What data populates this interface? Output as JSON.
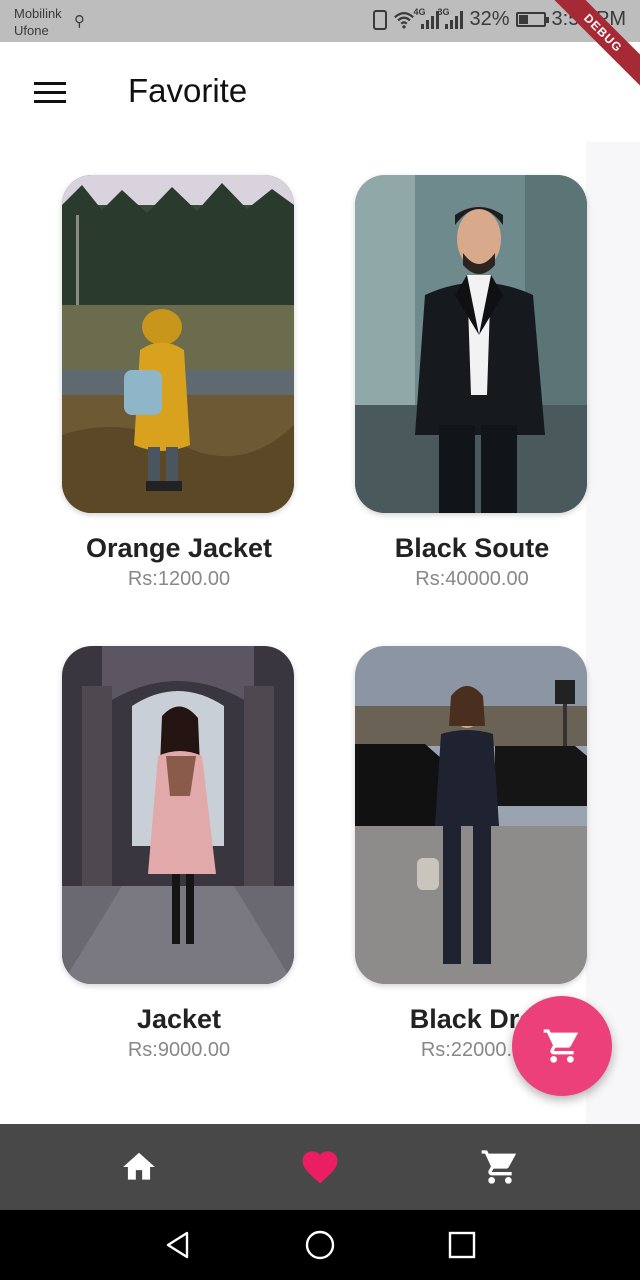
{
  "status_bar": {
    "carrier_1": "Mobilink",
    "carrier_2": "Ufone",
    "network_1": "4G",
    "network_2": "3G",
    "battery": "32%",
    "time": "3:58 PM"
  },
  "debug_banner": "DEBUG",
  "app_bar": {
    "title": "Favorite",
    "menu_icon": "menu-icon"
  },
  "products": [
    {
      "name": "Orange Jacket",
      "price": "Rs:1200.00",
      "image": "child in yellow jacket"
    },
    {
      "name": "Black Soute",
      "price": "Rs:40000.00",
      "image": "man in black suit"
    },
    {
      "name": "Jacket",
      "price": "Rs:9000.00",
      "image": "woman in pink coat"
    },
    {
      "name": "Black Dre",
      "price": "Rs:22000.0",
      "image": "woman in black pantsuit"
    }
  ],
  "fab": {
    "icon": "cart-icon",
    "color": "#ec407a"
  },
  "bottom_nav": {
    "items": [
      {
        "icon": "home-icon"
      },
      {
        "icon": "heart-icon",
        "active": true
      },
      {
        "icon": "cart-icon"
      }
    ],
    "background": "#484848",
    "active_color": "#ec407a"
  },
  "system_nav": [
    "back-icon",
    "home-circle-icon",
    "recents-icon"
  ]
}
